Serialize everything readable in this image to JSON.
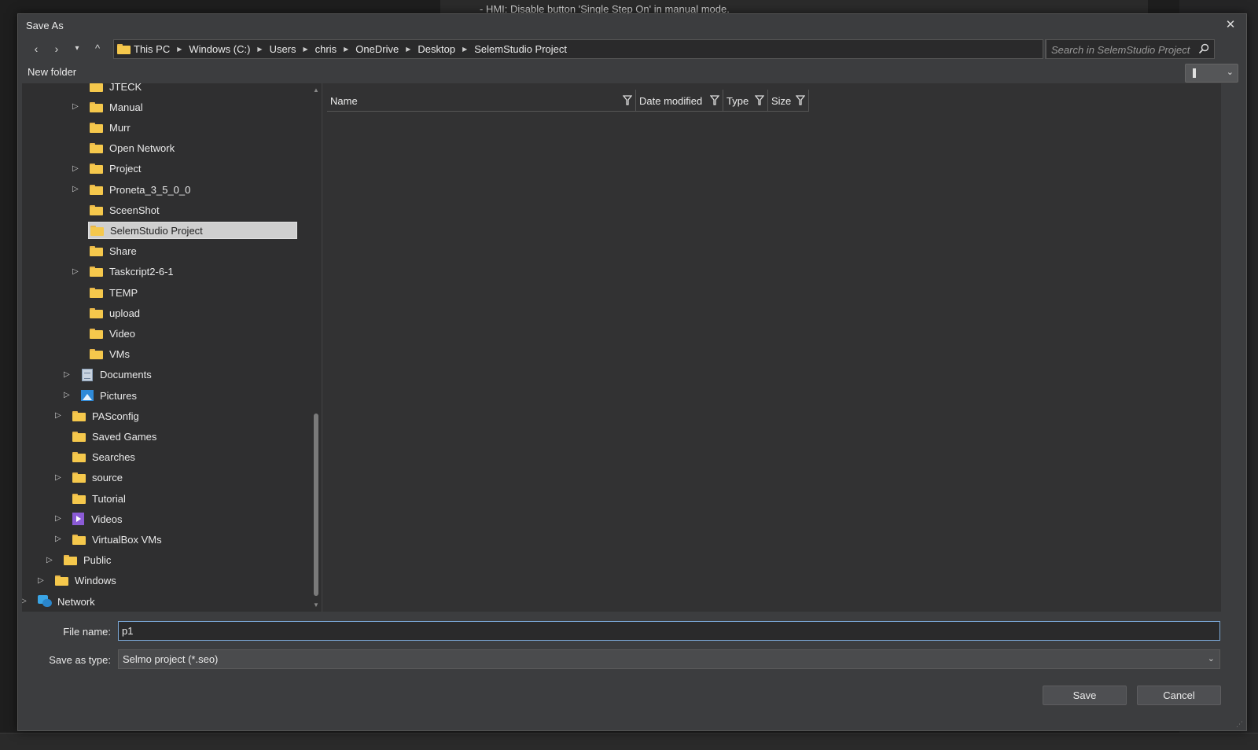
{
  "background": {
    "text": "-  HMI: Disable button 'Single Step On' in manual mode."
  },
  "dialog": {
    "title": "Save As",
    "close_glyph": "✕"
  },
  "nav": {
    "back_glyph": "‹",
    "forward_glyph": "›",
    "recent_glyph": "▾",
    "up_glyph": "^",
    "breadcrumbs": [
      "This PC",
      "Windows (C:)",
      "Users",
      "chris",
      "OneDrive",
      "Desktop",
      "SelemStudio Project"
    ],
    "search_placeholder": "Search in SelemStudio Project"
  },
  "toolbar": {
    "new_folder_label": "New folder"
  },
  "tree": {
    "items": [
      {
        "label": "JTECK",
        "icon": "folder-icon",
        "expandable": false
      },
      {
        "label": "Manual",
        "icon": "folder-icon",
        "expandable": true
      },
      {
        "label": "Murr",
        "icon": "folder-icon",
        "expandable": false
      },
      {
        "label": "Open Network",
        "icon": "folder-icon",
        "expandable": false
      },
      {
        "label": "Project",
        "icon": "folder-icon",
        "expandable": true
      },
      {
        "label": "Proneta_3_5_0_0",
        "icon": "folder-icon",
        "expandable": true
      },
      {
        "label": "SceenShot",
        "icon": "folder-icon",
        "expandable": false
      },
      {
        "label": "SelemStudio Project",
        "icon": "folder-icon",
        "expandable": false,
        "selected": true
      },
      {
        "label": "Share",
        "icon": "folder-icon",
        "expandable": false
      },
      {
        "label": "Taskcript2-6-1",
        "icon": "folder-icon",
        "expandable": true
      },
      {
        "label": "TEMP",
        "icon": "folder-icon",
        "expandable": false
      },
      {
        "label": "upload",
        "icon": "folder-icon",
        "expandable": false
      },
      {
        "label": "Video",
        "icon": "folder-icon",
        "expandable": false
      },
      {
        "label": "VMs",
        "icon": "folder-icon",
        "expandable": false
      },
      {
        "label": "Documents",
        "icon": "documents-icon",
        "expandable": true
      },
      {
        "label": "Pictures",
        "icon": "pictures-icon",
        "expandable": true
      },
      {
        "label": "PASconfig",
        "icon": "folder-icon",
        "expandable": true
      },
      {
        "label": "Saved Games",
        "icon": "folder-icon",
        "expandable": false
      },
      {
        "label": "Searches",
        "icon": "folder-icon",
        "expandable": false
      },
      {
        "label": "source",
        "icon": "folder-icon",
        "expandable": true
      },
      {
        "label": "Tutorial",
        "icon": "folder-icon",
        "expandable": false
      },
      {
        "label": "Videos",
        "icon": "videos-icon",
        "expandable": true
      },
      {
        "label": "VirtualBox VMs",
        "icon": "folder-icon",
        "expandable": true
      },
      {
        "label": "Public",
        "icon": "folder-icon",
        "expandable": true
      },
      {
        "label": "Windows",
        "icon": "folder-icon",
        "expandable": true
      },
      {
        "label": "Network",
        "icon": "network-icon",
        "expandable": true
      }
    ]
  },
  "list": {
    "columns": [
      "Name",
      "Date modified",
      "Type",
      "Size"
    ]
  },
  "form": {
    "file_name_label": "File name:",
    "file_name_value": "p1",
    "save_type_label": "Save as type:",
    "save_type_value": "Selmo project (*.seo)"
  },
  "buttons": {
    "save_label": "Save",
    "cancel_label": "Cancel"
  },
  "colors": {
    "dialog_bg": "#3c3d3f",
    "pane_bg": "#2f2f30",
    "folder": "#f5c84c",
    "focus_border": "#7aa7d6"
  }
}
